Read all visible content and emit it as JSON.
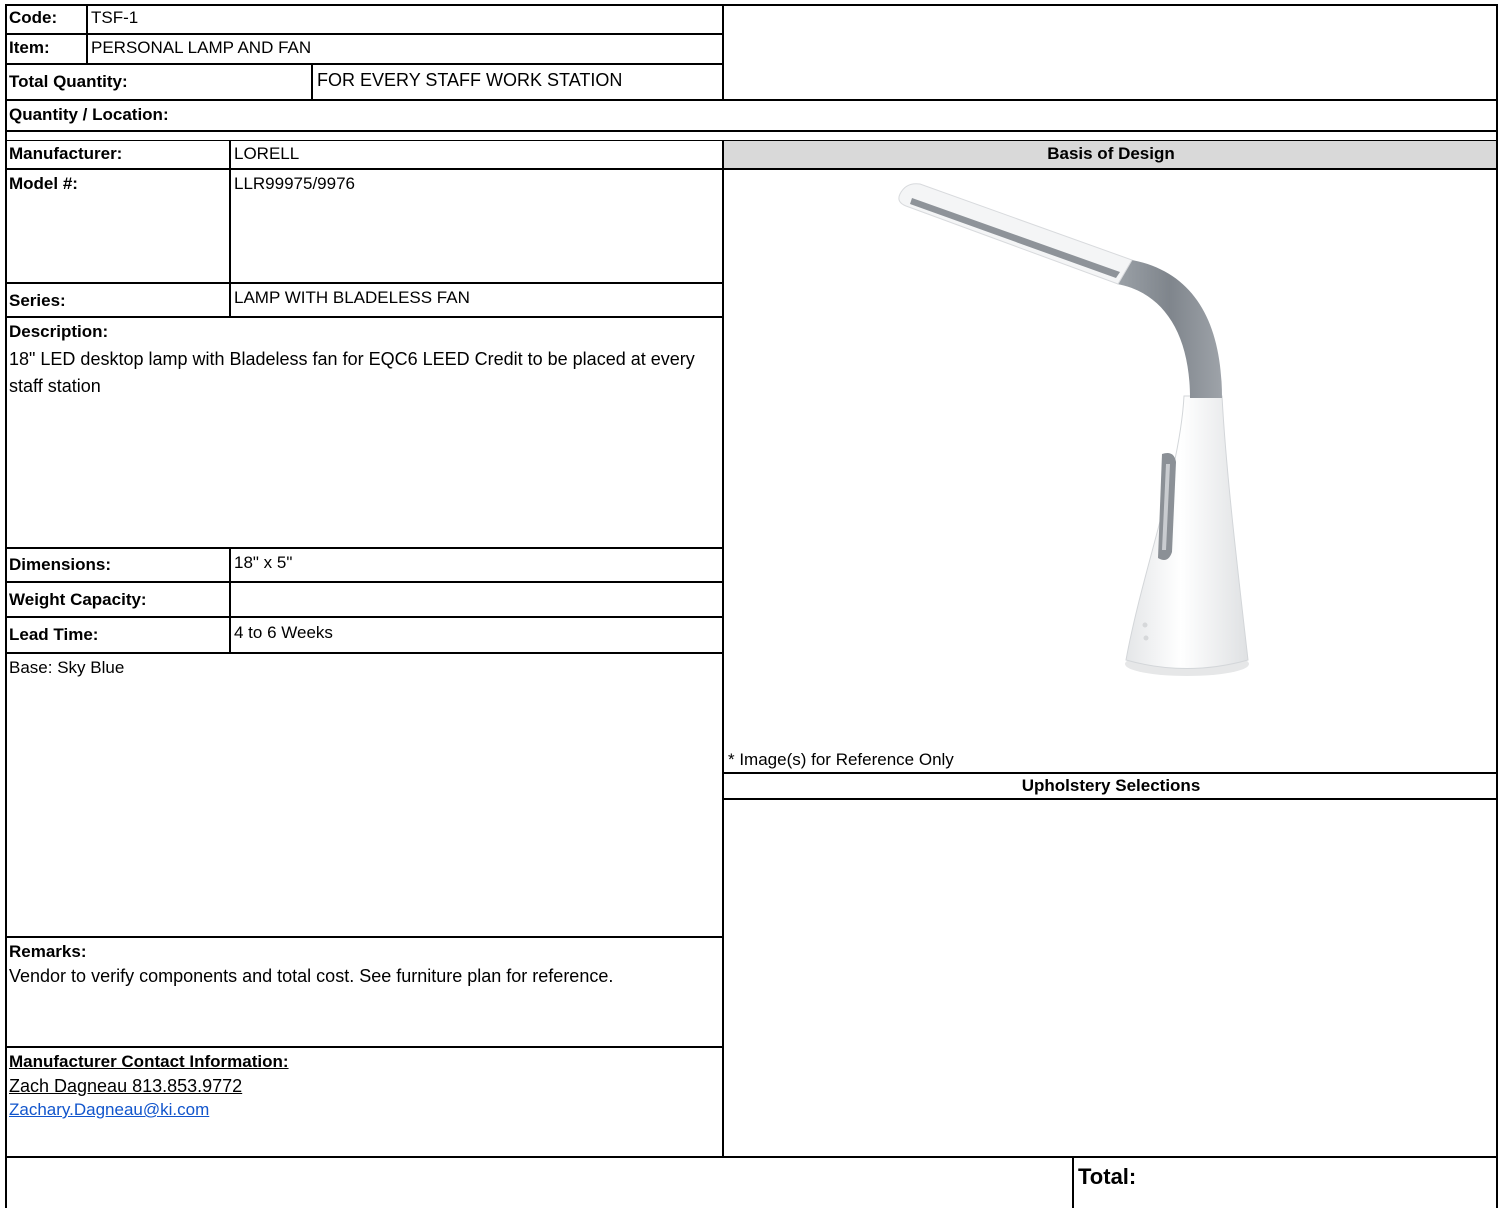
{
  "code": {
    "label": "Code:",
    "value": "TSF-1"
  },
  "item": {
    "label": "Item:",
    "value": "PERSONAL LAMP AND FAN"
  },
  "total_quantity": {
    "label": "Total Quantity:",
    "value": "FOR EVERY STAFF WORK STATION"
  },
  "quantity_location": {
    "label": "Quantity / Location:"
  },
  "manufacturer": {
    "label": "Manufacturer:",
    "value": "LORELL"
  },
  "model": {
    "label": "Model #:",
    "value": "LLR99975/9976"
  },
  "series": {
    "label": "Series:",
    "value": "LAMP WITH BLADELESS FAN"
  },
  "description": {
    "label": "Description:",
    "value": "18\" LED desktop lamp with Bladeless fan for EQC6 LEED Credit to be placed at every staff station"
  },
  "dimensions": {
    "label": "Dimensions:",
    "value": "18\" x 5\""
  },
  "weight_capacity": {
    "label": "Weight Capacity:",
    "value": ""
  },
  "lead_time": {
    "label": "Lead Time:",
    "value": "4 to 6 Weeks"
  },
  "finish": {
    "value": "Base: Sky Blue"
  },
  "remarks": {
    "label": "Remarks:",
    "value": "Vendor to verify components and total cost. See furniture plan for reference."
  },
  "contact": {
    "label": "Manufacturer Contact Information:",
    "name_phone": "Zach Dagneau 813.853.9772",
    "email": "Zachary.Dagneau@ki.com"
  },
  "basis_of_design": {
    "header": "Basis of Design",
    "image_note": "* Image(s) for Reference Only",
    "image_icon": "desk-lamp-with-bladeless-fan"
  },
  "upholstery": {
    "header": "Upholstery Selections"
  },
  "total": {
    "label": "Total:"
  },
  "colors": {
    "header_bg": "#d9d9d9",
    "link": "#1155cc",
    "lamp_gray": "#8e9399"
  }
}
